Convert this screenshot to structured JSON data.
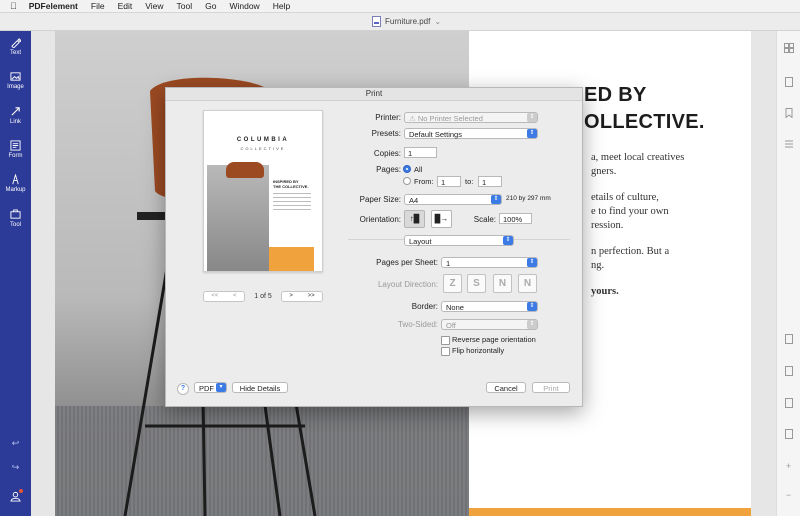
{
  "menubar": {
    "app_name": "PDFelement",
    "items": [
      "File",
      "Edit",
      "View",
      "Tool",
      "Go",
      "Window",
      "Help"
    ]
  },
  "window": {
    "document_title": "Furniture.pdf",
    "title_chevron": "⌄"
  },
  "sidebar": {
    "tools": [
      {
        "label": "Text",
        "icon": "text-edit-icon"
      },
      {
        "label": "Image",
        "icon": "image-icon"
      },
      {
        "label": "Link",
        "icon": "link-icon"
      },
      {
        "label": "Form",
        "icon": "form-icon"
      },
      {
        "label": "Markup",
        "icon": "markup-icon"
      },
      {
        "label": "Tool",
        "icon": "toolbox-icon"
      }
    ],
    "undo_icon": "undo-icon",
    "redo_icon": "redo-icon",
    "account_icon": "user-icon"
  },
  "document": {
    "headline_line1": "ED BY",
    "headline_line2": "OLLECTIVE.",
    "body_lines": [
      "a, meet local creatives",
      "gners.",
      "etails of culture,",
      "e to find your own",
      "ression.",
      "n perfection. But a",
      "ng.",
      "yours."
    ],
    "accent_color": "#f0a33c"
  },
  "print_dialog": {
    "title": "Print",
    "preview": {
      "brand": "COLUMBIA",
      "brand_sub": "COLLECTIVE",
      "heading_line1": "INSPIRED BY",
      "heading_line2": "THE COLLECTIVE.",
      "page_indicator": "1 of 5",
      "first_label": "<<",
      "prev_label": "<",
      "next_label": ">",
      "last_label": ">>"
    },
    "printer_label": "Printer:",
    "printer_value": "No Printer Selected",
    "presets_label": "Presets:",
    "presets_value": "Default Settings",
    "copies_label": "Copies:",
    "copies_value": "1",
    "pages_label": "Pages:",
    "pages_all_label": "All",
    "pages_from_label": "From:",
    "pages_from_value": "1",
    "pages_to_label": "to:",
    "pages_to_value": "1",
    "paper_size_label": "Paper Size:",
    "paper_size_value": "A4",
    "paper_size_dims": "210 by 297 mm",
    "orientation_label": "Orientation:",
    "scale_label": "Scale:",
    "scale_value": "100%",
    "section_value": "Layout",
    "pages_per_sheet_label": "Pages per Sheet:",
    "pages_per_sheet_value": "1",
    "layout_direction_label": "Layout Direction:",
    "border_label": "Border:",
    "border_value": "None",
    "two_sided_label": "Two-Sided:",
    "two_sided_value": "Off",
    "reverse_orientation_label": "Reverse page orientation",
    "flip_horizontally_label": "Flip horizontally",
    "help_label": "?",
    "pdf_label": "PDF",
    "hide_details_label": "Hide Details",
    "cancel_label": "Cancel",
    "print_label": "Print",
    "highlight_color": "#3c7ae6"
  }
}
